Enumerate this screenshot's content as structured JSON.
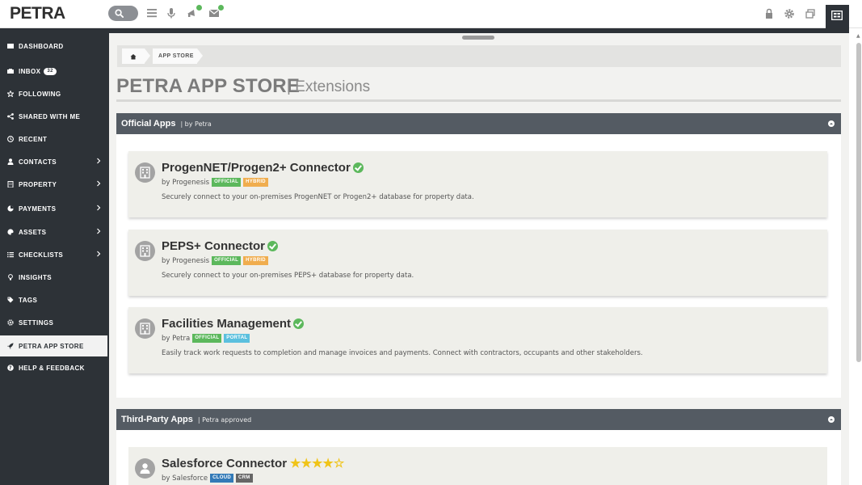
{
  "app": {
    "logo": "PETRA"
  },
  "topbar": {
    "icons": [
      "search-icon",
      "menu-icon",
      "microphone-icon",
      "announcement-icon",
      "mail-icon"
    ],
    "right_icons": [
      "lock-icon",
      "gear-icon",
      "window-icon",
      "app-panel-icon"
    ],
    "accent": "#5cb85c"
  },
  "sidebar": {
    "items": [
      {
        "label": "DASHBOARD",
        "icon": "dashboard-icon"
      },
      {
        "label": "INBOX",
        "icon": "inbox-icon",
        "count": "32"
      },
      {
        "label": "FOLLOWING",
        "icon": "star-icon"
      },
      {
        "label": "SHARED WITH ME",
        "icon": "share-icon"
      },
      {
        "label": "RECENT",
        "icon": "clock-icon"
      },
      {
        "label": "CONTACTS",
        "icon": "user-icon",
        "expandable": true
      },
      {
        "label": "PROPERTY",
        "icon": "building-icon",
        "expandable": true
      },
      {
        "label": "PAYMENTS",
        "icon": "payments-icon",
        "expandable": true
      },
      {
        "label": "ASSETS",
        "icon": "palette-icon",
        "expandable": true
      },
      {
        "label": "CHECKLISTS",
        "icon": "list-icon",
        "expandable": true
      },
      {
        "label": "INSIGHTS",
        "icon": "lightbulb-icon"
      },
      {
        "label": "TAGS",
        "icon": "tags-icon"
      },
      {
        "label": "SETTINGS",
        "icon": "gear-icon"
      },
      {
        "label": "PETRA APP STORE",
        "icon": "rocket-icon",
        "active": true
      },
      {
        "label": "HELP & FEEDBACK",
        "icon": "help-icon"
      }
    ]
  },
  "breadcrumb": {
    "home_icon": "home-icon",
    "current": "APP STORE"
  },
  "page": {
    "title": "PETRA APP STORE",
    "subtitle": "| Extensions"
  },
  "sections": [
    {
      "title": "Official Apps",
      "subtitle": "| by Petra",
      "apps": [
        {
          "name": "ProgenNET/Progen2+ Connector",
          "by": "by Progenesis",
          "tags": [
            {
              "label": "OFFICIAL",
              "color": "#5cb85c"
            },
            {
              "label": "HYBRID",
              "color": "#f0ad4e"
            }
          ],
          "description": "Securely connect to your on-premises ProgenNET or Progen2+ database for property data.",
          "icon": "building-icon",
          "verified": true
        },
        {
          "name": "PEPS+ Connector",
          "by": "by Progenesis",
          "tags": [
            {
              "label": "OFFICIAL",
              "color": "#5cb85c"
            },
            {
              "label": "HYBRID",
              "color": "#f0ad4e"
            }
          ],
          "description": "Securely connect to your on-premises PEPS+ database for property data.",
          "icon": "building-icon",
          "verified": true
        },
        {
          "name": "Facilities Management",
          "by": "by Petra",
          "tags": [
            {
              "label": "OFFICIAL",
              "color": "#5cb85c"
            },
            {
              "label": "PORTAL",
              "color": "#5bc0de"
            }
          ],
          "description": "Easily track work requests to completion and manage invoices and payments. Connect with contractors, occupants and other stakeholders.",
          "icon": "building-icon",
          "verified": true
        }
      ]
    },
    {
      "title": "Third-Party Apps",
      "subtitle": "| Petra approved",
      "apps": [
        {
          "name": "Salesforce Connector",
          "by": "by Salesforce",
          "tags": [
            {
              "label": "CLOUD",
              "color": "#337ab7"
            },
            {
              "label": "CRM",
              "color": "#666666"
            }
          ],
          "rating": 4,
          "rating_max": 5,
          "icon": "user-icon"
        }
      ]
    }
  ]
}
